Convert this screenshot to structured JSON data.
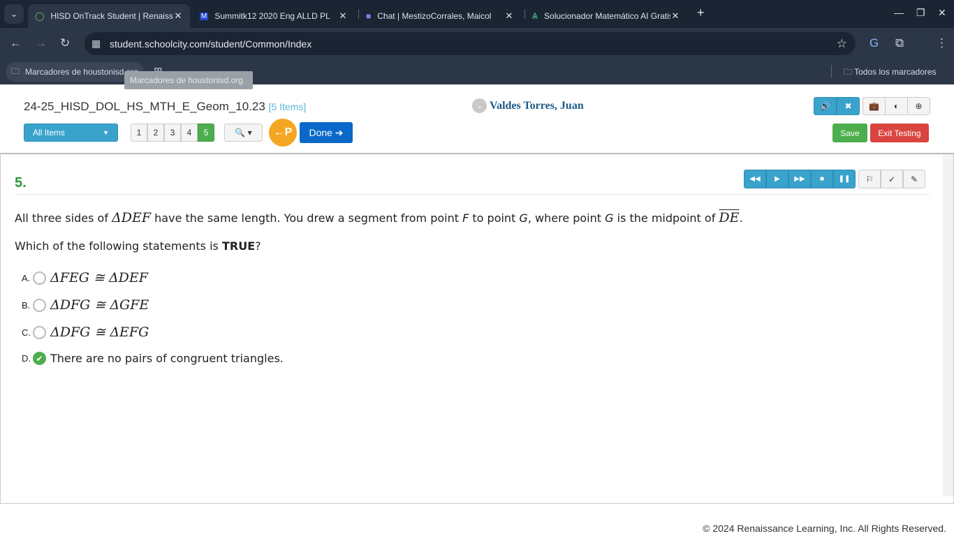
{
  "browser": {
    "tabs": [
      {
        "title": "HISD OnTrack Student | Renaissance",
        "active": true
      },
      {
        "title": "Summitk12 2020 Eng ALLD PL"
      },
      {
        "title": "Chat | MestizoCorrales, Maicol"
      },
      {
        "title": "Solucionador Matemático AI Gratis"
      }
    ],
    "url": "student.schoolcity.com/student/Common/Index",
    "bookmarks": {
      "folder": "Marcadores de houstonisd.org",
      "tooltip": "Marcadores de houstonisd.org",
      "all": "Todos los marcadores"
    }
  },
  "header": {
    "test_title": "24-25_HISD_DOL_HS_MTH_E_Geom_10.23",
    "item_count": "[5 Items]",
    "student_name": "Valdes Torres, Juan",
    "all_items": "All Items",
    "item_numbers": [
      "1",
      "2",
      "3",
      "4",
      "5"
    ],
    "current_item": "5",
    "pause_label": "P",
    "done_label": "Done",
    "save_label": "Save",
    "exit_label": "Exit Testing",
    "accent": "#3aa3cc"
  },
  "question": {
    "number": "5.",
    "text_parts": [
      "All three sides of ",
      "ΔDEF",
      " have the same length. You drew a segment from point ",
      "F",
      " to point ",
      "G",
      ", where point ",
      "G",
      " is the midpoint of ",
      "DE",
      "."
    ],
    "prompt_pre": "Which of the following statements is ",
    "prompt_bold": "TRUE",
    "prompt_post": "?",
    "options": [
      {
        "letter": "A.",
        "text": "ΔFEG ≅ ΔDEF",
        "selected": false
      },
      {
        "letter": "B.",
        "text": "ΔDFG ≅ ΔGFE",
        "selected": false
      },
      {
        "letter": "C.",
        "text": "ΔDFG ≅ ΔEFG",
        "selected": false
      },
      {
        "letter": "D.",
        "text": "There are no pairs of congruent triangles.",
        "selected": true
      }
    ]
  },
  "footer": "© 2024 Renaissance Learning, Inc. All Rights Reserved."
}
